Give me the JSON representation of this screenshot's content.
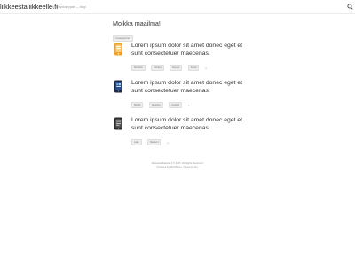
{
  "header": {
    "site_title": "liikkeestaliikkeelle.fi",
    "tagline": "Yhteistyökumppani — blogi"
  },
  "main": {
    "page_title": "Moikka maailma!",
    "page_tags": [
      "Uncategorized"
    ],
    "posts": [
      {
        "title": "Lorem ipsum dolor sit amet donec eget et sunt consectetuer maecenas.",
        "tags": [
          "Muotoilu",
          "Kehitys",
          "Design",
          "Koodi"
        ],
        "more": "+"
      },
      {
        "title": "Lorem ipsum dolor sit amet donec eget et sunt consectetuer maecenas.",
        "tags": [
          "Mobiili",
          "Sovellus",
          "Android"
        ],
        "more": "+"
      },
      {
        "title": "Lorem ipsum dolor sit amet donec eget et sunt consectetuer maecenas.",
        "tags": [
          "Laite",
          "Moderni"
        ],
        "more": "+"
      }
    ]
  },
  "footer": {
    "line1": "liikkeestaliikkeelle.fi © 2015. All Rights Reserved.",
    "line2": "Powered by WordPress. Theme by Alx."
  },
  "colors": {
    "accent": "#f5a020",
    "phone_blue": "#2b4f8e",
    "phone_dark": "#3a3a3a"
  },
  "icons": {
    "search": "search-icon"
  }
}
